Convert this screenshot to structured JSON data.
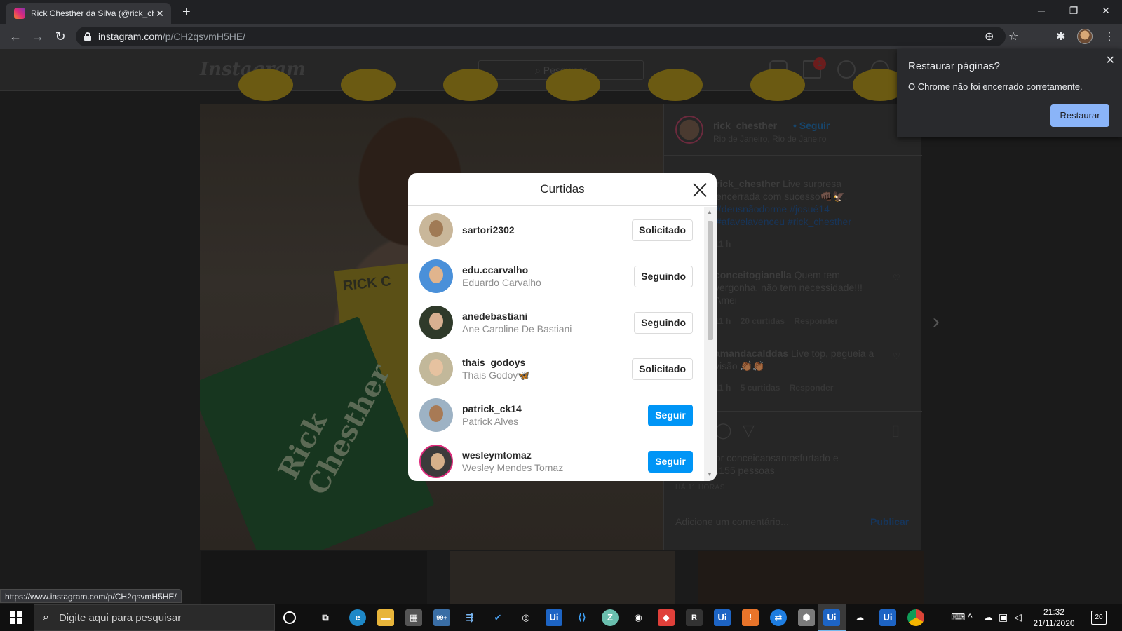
{
  "browser": {
    "tab_title": "Rick Chesther da Silva (@rick_che",
    "url_host": "instagram.com",
    "url_path": "/p/CH2qsvmH5HE/",
    "status_url": "https://www.instagram.com/p/CH2qsvmH5HE/"
  },
  "instagram": {
    "logo": "Instagram",
    "search_placeholder": "Pesquisar",
    "notif_count": "1",
    "post": {
      "username": "rick_chesther",
      "follow_label": "• Seguir",
      "location": "Rio de Janeiro, Rio de Janeiro",
      "caption_user": "rick_chesther",
      "caption_line1": "Live surpresa",
      "caption_line2": "encerrada com sucesso👊🏿🦅.",
      "caption_line3": "#deusnãodorme #josué14",
      "caption_line4": "#afavelavenceu #rick_chesther",
      "caption_time": "11 h",
      "comments": [
        {
          "user": "conceitogianella",
          "text1": "Quem tem",
          "text2": "vergonha, não tem necessidade!!!",
          "text3": "Amei",
          "time": "11 h",
          "likes": "20 curtidas",
          "reply": "Responder"
        },
        {
          "user": "amandacalddas",
          "text1": "Live top, pegueia a",
          "text2": "visão 👏🏾👏🏾",
          "text3": "",
          "time": "11 h",
          "likes": "5 curtidas",
          "reply": "Responder"
        }
      ],
      "liked_by_line1": "Curtido por conceicaosantosfurtado e",
      "liked_by_line2": "outras 14.155 pessoas",
      "time_ago": "HÁ 11 HORAS",
      "comment_placeholder": "Adicione um comentário...",
      "publish": "Publicar",
      "book_yellow": "RICK C",
      "book_green": "Rick Chesther"
    }
  },
  "likes_modal": {
    "title": "Curtidas",
    "users": [
      {
        "username": "sartori2302",
        "full_name": "",
        "button": "Solicitado",
        "style": "outline",
        "avatar": "#c9b79a",
        "face": "#a07a55"
      },
      {
        "username": "edu.ccarvalho",
        "full_name": "Eduardo Carvalho",
        "button": "Seguindo",
        "style": "outline",
        "avatar": "#4a90d9",
        "face": "#e0b48d"
      },
      {
        "username": "anedebastiani",
        "full_name": "Ane Caroline De Bastiani",
        "button": "Seguindo",
        "style": "outline",
        "avatar": "#2f3a2a",
        "face": "#d8b091"
      },
      {
        "username": "thais_godoys",
        "full_name": "Thais Godoy🦋",
        "button": "Solicitado",
        "style": "outline",
        "avatar": "#c2b89a",
        "face": "#e6c2a0"
      },
      {
        "username": "patrick_ck14",
        "full_name": "Patrick Alves",
        "button": "Seguir",
        "style": "primary",
        "avatar": "#9db2c4",
        "face": "#a87a55"
      },
      {
        "username": "wesleymtomaz",
        "full_name": "Wesley Mendes Tomaz",
        "button": "Seguir",
        "style": "primary",
        "avatar": "#3b3b3b",
        "face": "#d6b08a"
      }
    ]
  },
  "restore_bubble": {
    "title": "Restaurar páginas?",
    "body": "O Chrome não foi encerrado corretamente.",
    "button": "Restaurar"
  },
  "taskbar": {
    "search_placeholder": "Digite aqui para pesquisar",
    "mail_badge": "99+",
    "time": "21:32",
    "date": "21/11/2020",
    "notifications": "20"
  }
}
